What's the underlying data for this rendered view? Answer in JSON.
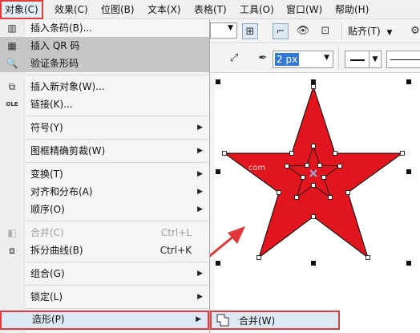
{
  "menubar": [
    {
      "label": "对象(C)",
      "active": true
    },
    {
      "label": "效果(C)"
    },
    {
      "label": "位图(B)"
    },
    {
      "label": "文本(X)"
    },
    {
      "label": "表格(T)"
    },
    {
      "label": "工具(O)"
    },
    {
      "label": "窗口(W)"
    },
    {
      "label": "帮助(H)"
    }
  ],
  "toolbar": {
    "align_label": "贴齐(T)",
    "outline_width": "2 px"
  },
  "menu": {
    "items": [
      {
        "label": "插入条码(B)...",
        "icon": "barcode-icon"
      },
      {
        "label": "插入 QR 码",
        "icon": "qr-code-icon",
        "highlighted": true
      },
      {
        "label": "验证条形码",
        "icon": "magnifier-icon",
        "highlighted": true
      },
      {
        "label": "插入新对象(W)...",
        "icon": "insert-object-icon"
      },
      {
        "label": "链接(K)...",
        "icon": "ole-icon",
        "icon_text": "OLE"
      },
      {
        "label": "符号(Y)",
        "submenu": true
      },
      {
        "label": "图框精确剪裁(W)",
        "submenu": true
      },
      {
        "label": "变换(T)",
        "submenu": true
      },
      {
        "label": "对齐和分布(A)",
        "submenu": true
      },
      {
        "label": "顺序(O)",
        "submenu": true
      },
      {
        "label": "合并(C)",
        "shortcut": "Ctrl+L",
        "disabled": true,
        "icon": "combine-icon"
      },
      {
        "label": "拆分曲线(B)",
        "shortcut": "Ctrl+K",
        "icon": "break-apart-icon"
      },
      {
        "label": "组合(G)",
        "submenu": true
      },
      {
        "label": "锁定(L)",
        "submenu": true
      },
      {
        "label": "造形(P)",
        "submenu": true,
        "selected": true
      }
    ]
  },
  "submenu": {
    "label": "合并(W)"
  },
  "canvas": {
    "watermark": "com",
    "star_color": "#e0151e"
  }
}
